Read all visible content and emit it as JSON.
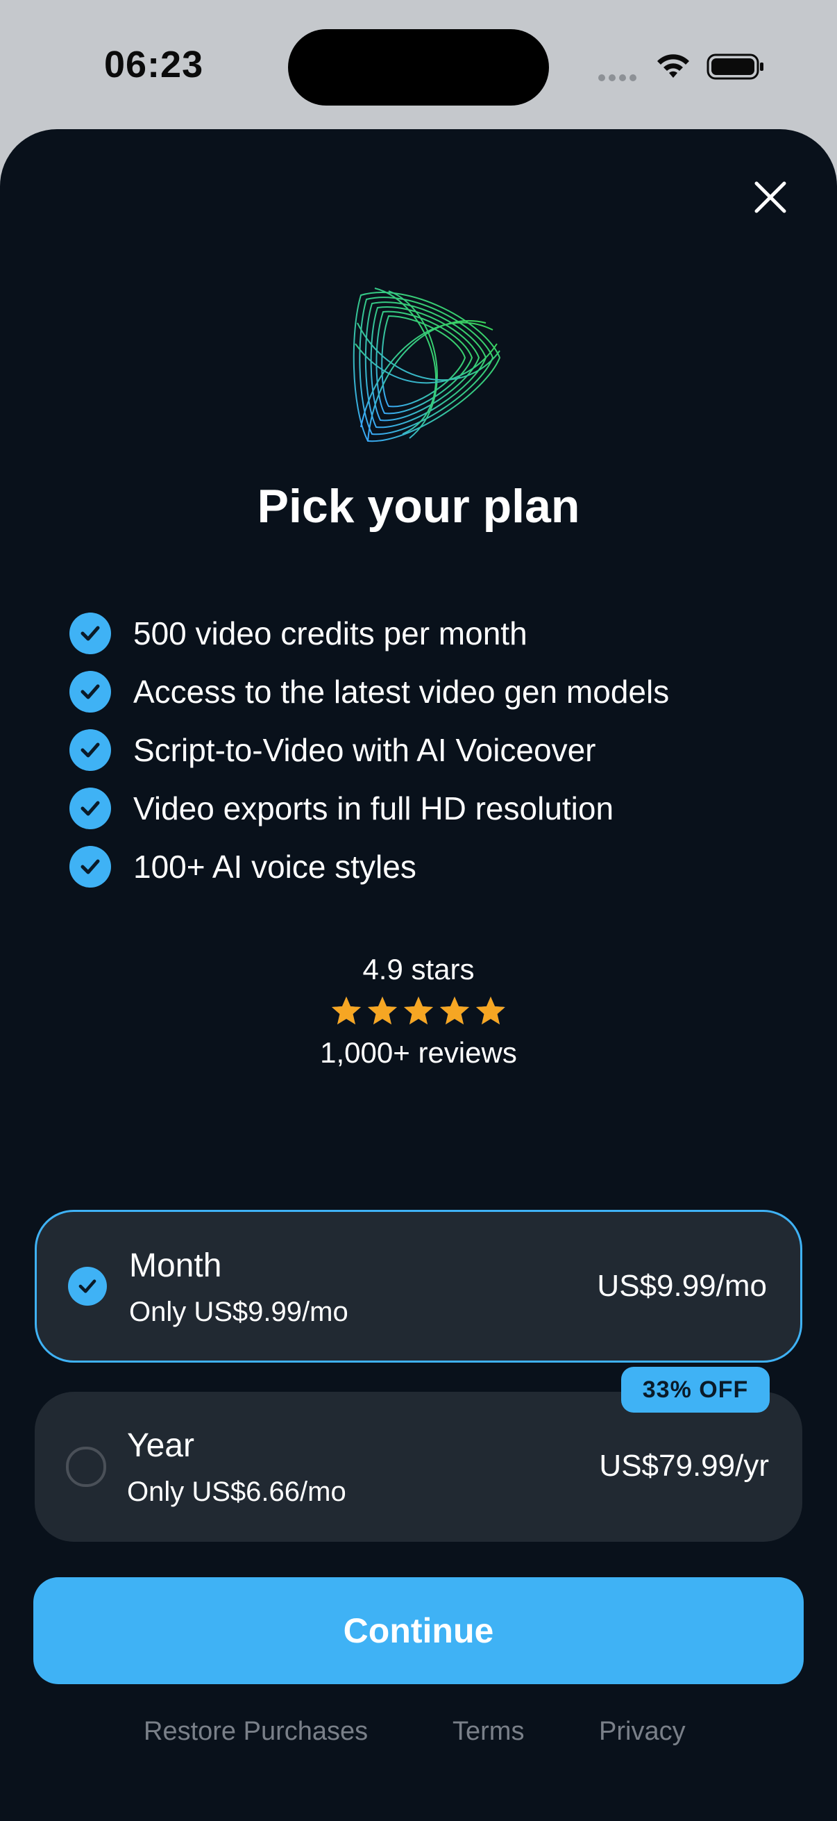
{
  "status": {
    "time": "06:23"
  },
  "title": "Pick your plan",
  "features": [
    "500 video credits per month",
    "Access to the latest video gen models",
    "Script-to-Video with AI Voiceover",
    "Video exports in full HD resolution",
    "100+ AI voice styles"
  ],
  "rating": {
    "score": "4.9 stars",
    "reviews": "1,000+ reviews",
    "star_fill": 4.9,
    "star_color": "#f6a623"
  },
  "plans": {
    "month": {
      "name": "Month",
      "sub": "Only US$9.99/mo",
      "price": "US$9.99/mo",
      "selected": true
    },
    "year": {
      "name": "Year",
      "sub": "Only US$6.66/mo",
      "price": "US$79.99/yr",
      "selected": false,
      "badge": "33% OFF"
    }
  },
  "continue_label": "Continue",
  "footer": {
    "restore": "Restore Purchases",
    "terms": "Terms",
    "privacy": "Privacy"
  },
  "colors": {
    "accent": "#3fb2f5",
    "background": "#09111b",
    "card": "#212932"
  }
}
